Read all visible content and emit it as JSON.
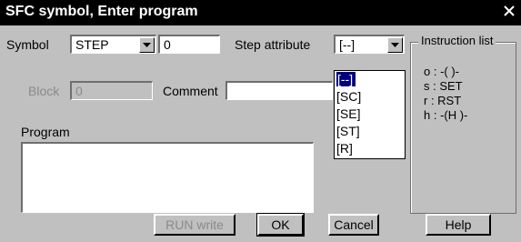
{
  "window": {
    "title": "SFC symbol, Enter program",
    "close_icon": "close-icon"
  },
  "form": {
    "symbol_label": "Symbol",
    "symbol_value": "STEP",
    "step_no_value": "0",
    "step_attribute_label": "Step attribute",
    "step_attribute_value": "[--]",
    "block_label": "Block",
    "block_value": "0",
    "comment_label": "Comment",
    "comment_value": "",
    "program_label": "Program",
    "program_value": ""
  },
  "step_attribute_dropdown": {
    "options": [
      "[--]",
      "[SC]",
      "[SE]",
      "[ST]",
      "[R]"
    ],
    "selected_index": 0
  },
  "instruction_list": {
    "title": "Instruction list",
    "items": [
      "o : -( )-",
      "s : SET",
      "r : RST",
      "h : -(H )-"
    ]
  },
  "buttons": {
    "run_write": "RUN write",
    "ok": "OK",
    "cancel": "Cancel",
    "help": "Help"
  },
  "colors": {
    "face": "#c0c0c0",
    "titlebar": "#000000",
    "selection": "#000080",
    "disabled_text": "#8a8a8a"
  }
}
